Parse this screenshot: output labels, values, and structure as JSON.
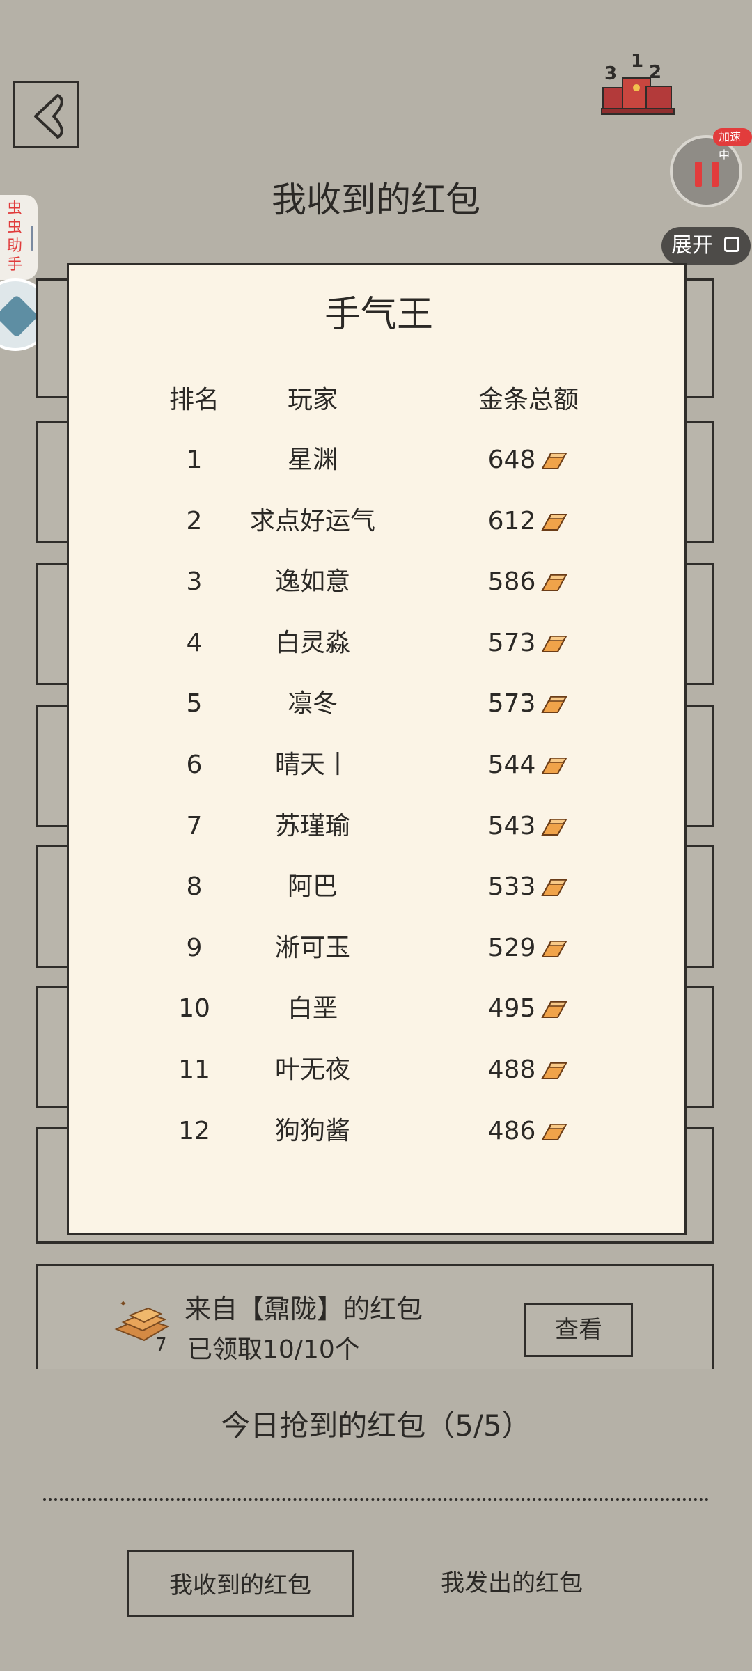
{
  "header": {
    "page_title": "我收到的红包",
    "back_icon": "back-arrow-icon",
    "ranking_icon": "ranking-podium-icon",
    "ranking_digits": [
      "3",
      "1",
      "2"
    ]
  },
  "overlay": {
    "speed_badge": "加速中",
    "expand_label": "展开",
    "side_helper_label": "虫虫助手"
  },
  "leaderboard": {
    "title": "手气王",
    "headers": {
      "rank": "排名",
      "player": "玩家",
      "total": "金条总额"
    },
    "rows": [
      {
        "rank": "1",
        "player": "星渊",
        "total": "648"
      },
      {
        "rank": "2",
        "player": "求点好运气",
        "total": "612"
      },
      {
        "rank": "3",
        "player": "逸如意",
        "total": "586"
      },
      {
        "rank": "4",
        "player": "白灵淼",
        "total": "573"
      },
      {
        "rank": "5",
        "player": "凛冬",
        "total": "573"
      },
      {
        "rank": "6",
        "player": "晴天丨",
        "total": "544"
      },
      {
        "rank": "7",
        "player": "苏瑾瑜",
        "total": "543"
      },
      {
        "rank": "8",
        "player": "阿巴",
        "total": "533"
      },
      {
        "rank": "9",
        "player": "淅可玉",
        "total": "529"
      },
      {
        "rank": "10",
        "player": "白垩",
        "total": "495"
      },
      {
        "rank": "11",
        "player": "叶无夜",
        "total": "488"
      },
      {
        "rank": "12",
        "player": "狗狗酱",
        "total": "486"
      }
    ]
  },
  "packet": {
    "from_label": "来自【鼐陇】的红包",
    "status": "已领取10/10个",
    "count": "7",
    "view_button": "查看"
  },
  "today": {
    "title": "今日抢到的红包（5/5）"
  },
  "tabs": {
    "received": "我收到的红包",
    "sent": "我发出的红包"
  },
  "colors": {
    "background": "#b5b1a7",
    "paper": "#fbf4e6",
    "ink": "#2f2d2a",
    "accent_red": "#e23c3c",
    "gold": "#f0a34a"
  }
}
